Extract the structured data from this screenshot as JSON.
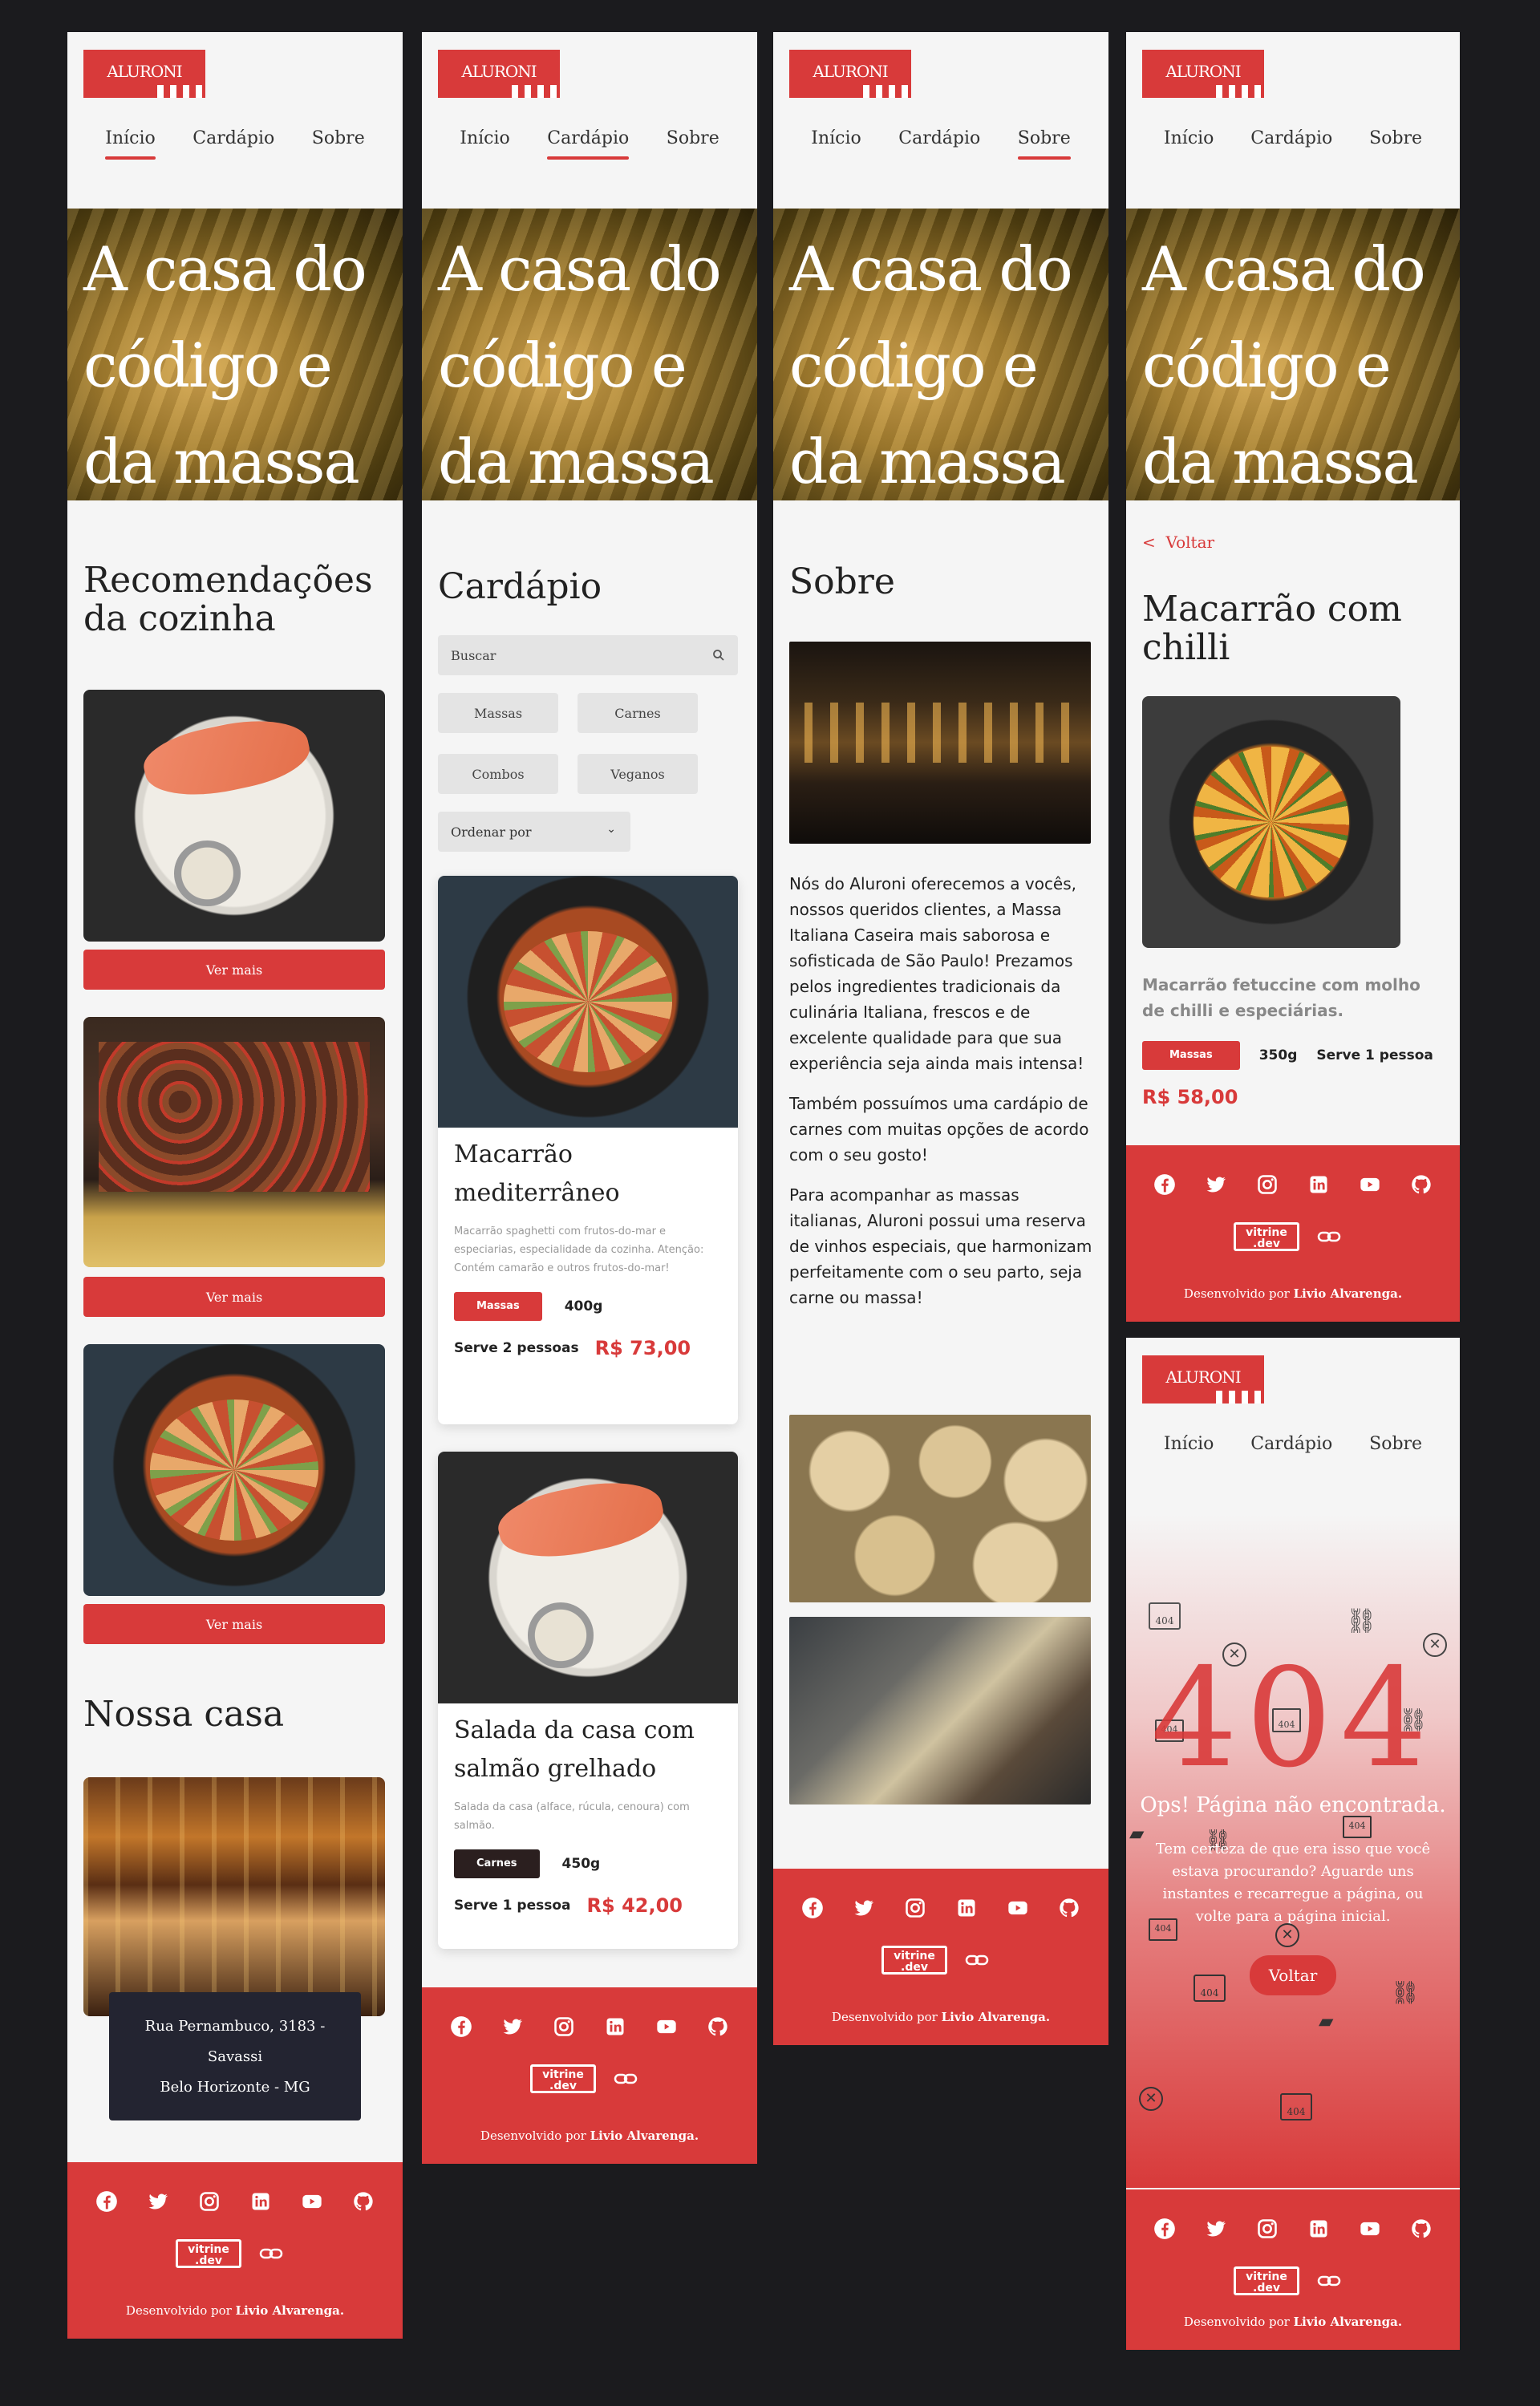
{
  "brand": {
    "logo": "ALURONI",
    "accent": "#d83a3a"
  },
  "nav": {
    "inicio": "Início",
    "cardapio": "Cardápio",
    "sobre": "Sobre"
  },
  "hero": {
    "title": "A casa do código e da massa"
  },
  "home": {
    "recs_title": "Recomendações da cozinha",
    "ver_mais": "Ver mais",
    "nossa_casa": "Nossa casa",
    "address": {
      "line1": "Rua Pernambuco, 3183 -",
      "line2": "Savassi",
      "line3": "Belo Horizonte - MG"
    }
  },
  "menu": {
    "title": "Cardápio",
    "search_placeholder": "Buscar",
    "filters": [
      "Massas",
      "Carnes",
      "Combos",
      "Veganos"
    ],
    "sort_label": "Ordenar por",
    "items": [
      {
        "name": "Macarrão mediterrâneo",
        "description": "Macarrão spaghetti com frutos-do-mar e especiarias, especialidade da cozinha. Atenção: Contém camarão e outros frutos-do-mar!",
        "category": "Massas",
        "size": "400g",
        "serves": "Serve 2 pessoas",
        "price": "R$ 73,00"
      },
      {
        "name": "Salada da casa com salmão grelhado",
        "description": "Salada da casa (alface, rúcula, cenoura) com salmão.",
        "category": "Carnes",
        "size": "450g",
        "serves": "Serve 1 pessoa",
        "price": "R$ 42,00"
      }
    ]
  },
  "about": {
    "title": "Sobre",
    "p1": "Nós do Aluroni oferecemos a vocês, nossos queridos clientes, a Massa Italiana Caseira mais saborosa e sofisticada de São Paulo! Prezamos pelos ingredientes tradicionais da culinária Italiana, frescos e de excelente qualidade para que sua experiência seja ainda mais intensa!",
    "p2": "Também possuímos uma cardápio de carnes com muitas opções de acordo com o seu gosto!",
    "p3": "Para acompanhar as massas italianas, Aluroni possui uma reserva de vinhos especiais, que harmonizam perfeitamente com o seu parto, seja carne ou massa!"
  },
  "detail": {
    "back": "Voltar",
    "name": "Macarrão com chilli",
    "description": "Macarrão fetuccine com molho de chilli e especiárias.",
    "category": "Massas",
    "size": "350g",
    "serves": "Serve 1 pessoa",
    "price": "R$ 58,00"
  },
  "notfound": {
    "code": "404",
    "title": "Ops! Página não encontrada.",
    "message": "Tem certeza de que era isso que você estava procurando? Aguarde uns instantes e recarregue a página, ou volte para a página inicial.",
    "button": "Voltar",
    "icon_label": "404"
  },
  "footer": {
    "social": [
      "facebook-icon",
      "twitter-icon",
      "instagram-icon",
      "linkedin-icon",
      "youtube-icon",
      "github-icon"
    ],
    "vitrine_line1": "vitrine",
    "vitrine_line2": ".dev",
    "credit_prefix": "Desenvolvido por",
    "credit_name": "Livio Alvarenga."
  },
  "colors": {
    "primary": "#d83a3a",
    "dark": "#232431",
    "tag_dark": "#2b1f1f",
    "page_bg": "#1b1b1e"
  }
}
